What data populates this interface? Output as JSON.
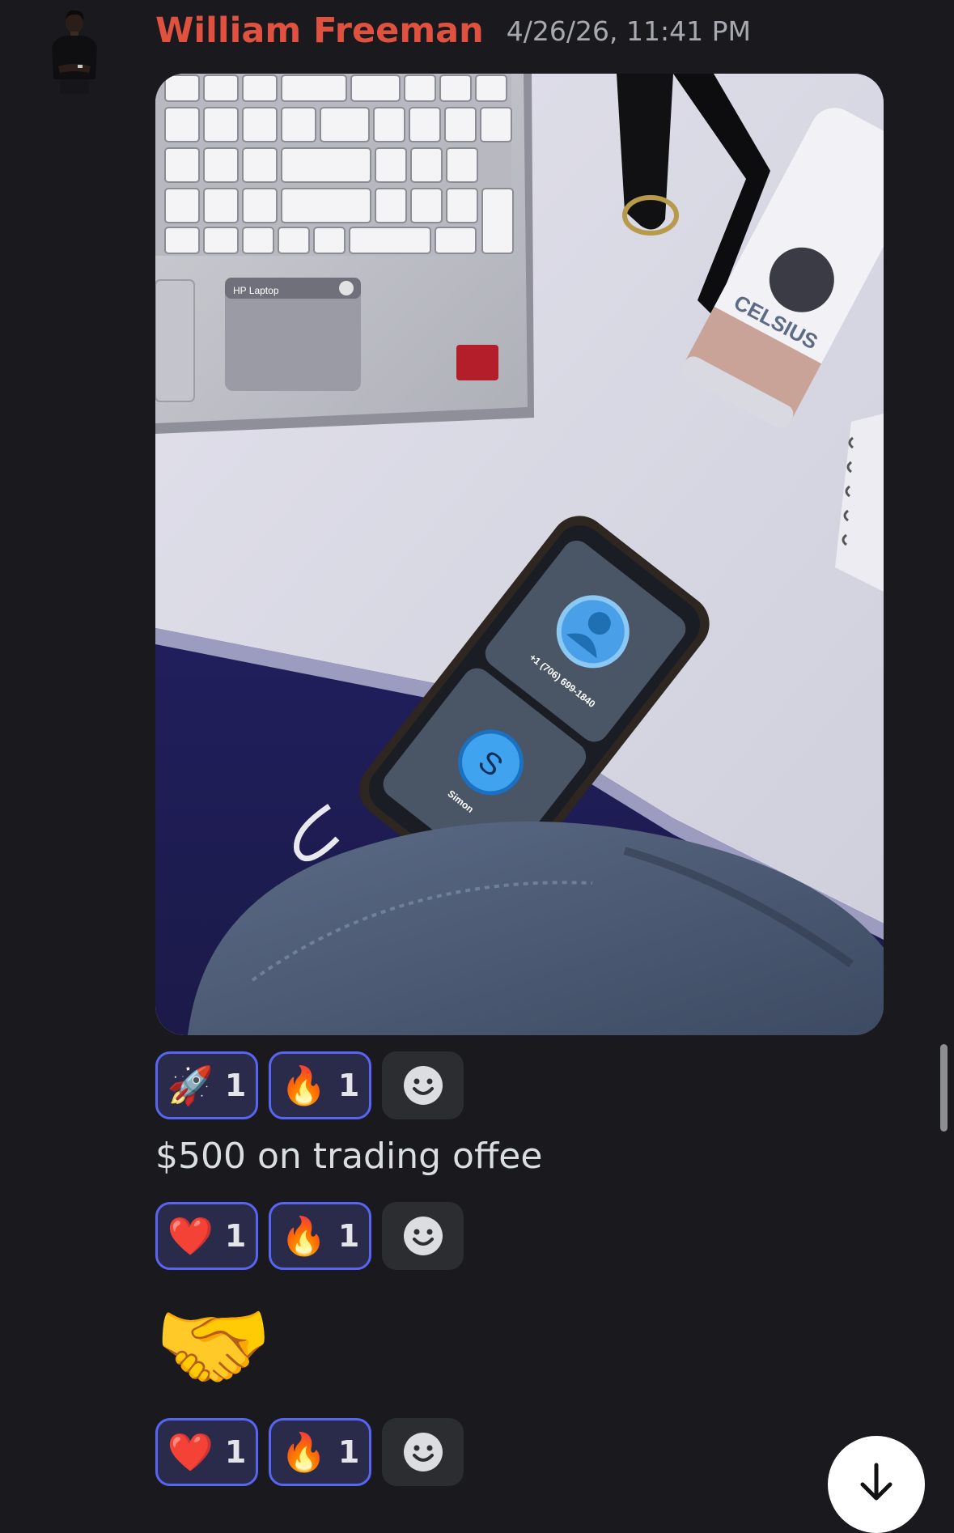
{
  "message": {
    "author": "William Freeman",
    "timestamp": "4/26/26, 11:41 PM"
  },
  "photo_reactions": [
    {
      "emoji": "🚀",
      "count": "1"
    },
    {
      "emoji": "🔥",
      "count": "1"
    }
  ],
  "text_message": "$500 on trading offee",
  "text_reactions": [
    {
      "emoji": "❤️",
      "count": "1"
    },
    {
      "emoji": "🔥",
      "count": "1"
    }
  ],
  "emoji_message": "🤝",
  "emoji_reactions": [
    {
      "emoji": "❤️",
      "count": "1"
    },
    {
      "emoji": "🔥",
      "count": "1"
    }
  ],
  "attachment": {
    "laptop_label": "HP Laptop",
    "phone_number": "+1 (706) 699-1840",
    "contact_initial": "S",
    "contact_name": "Simon",
    "can_label": "CELSIUS"
  },
  "colors": {
    "author": "#e0523f",
    "reaction_border": "#5865f2",
    "reaction_bg": "#2a2b4a",
    "background": "#1a1a1e"
  }
}
